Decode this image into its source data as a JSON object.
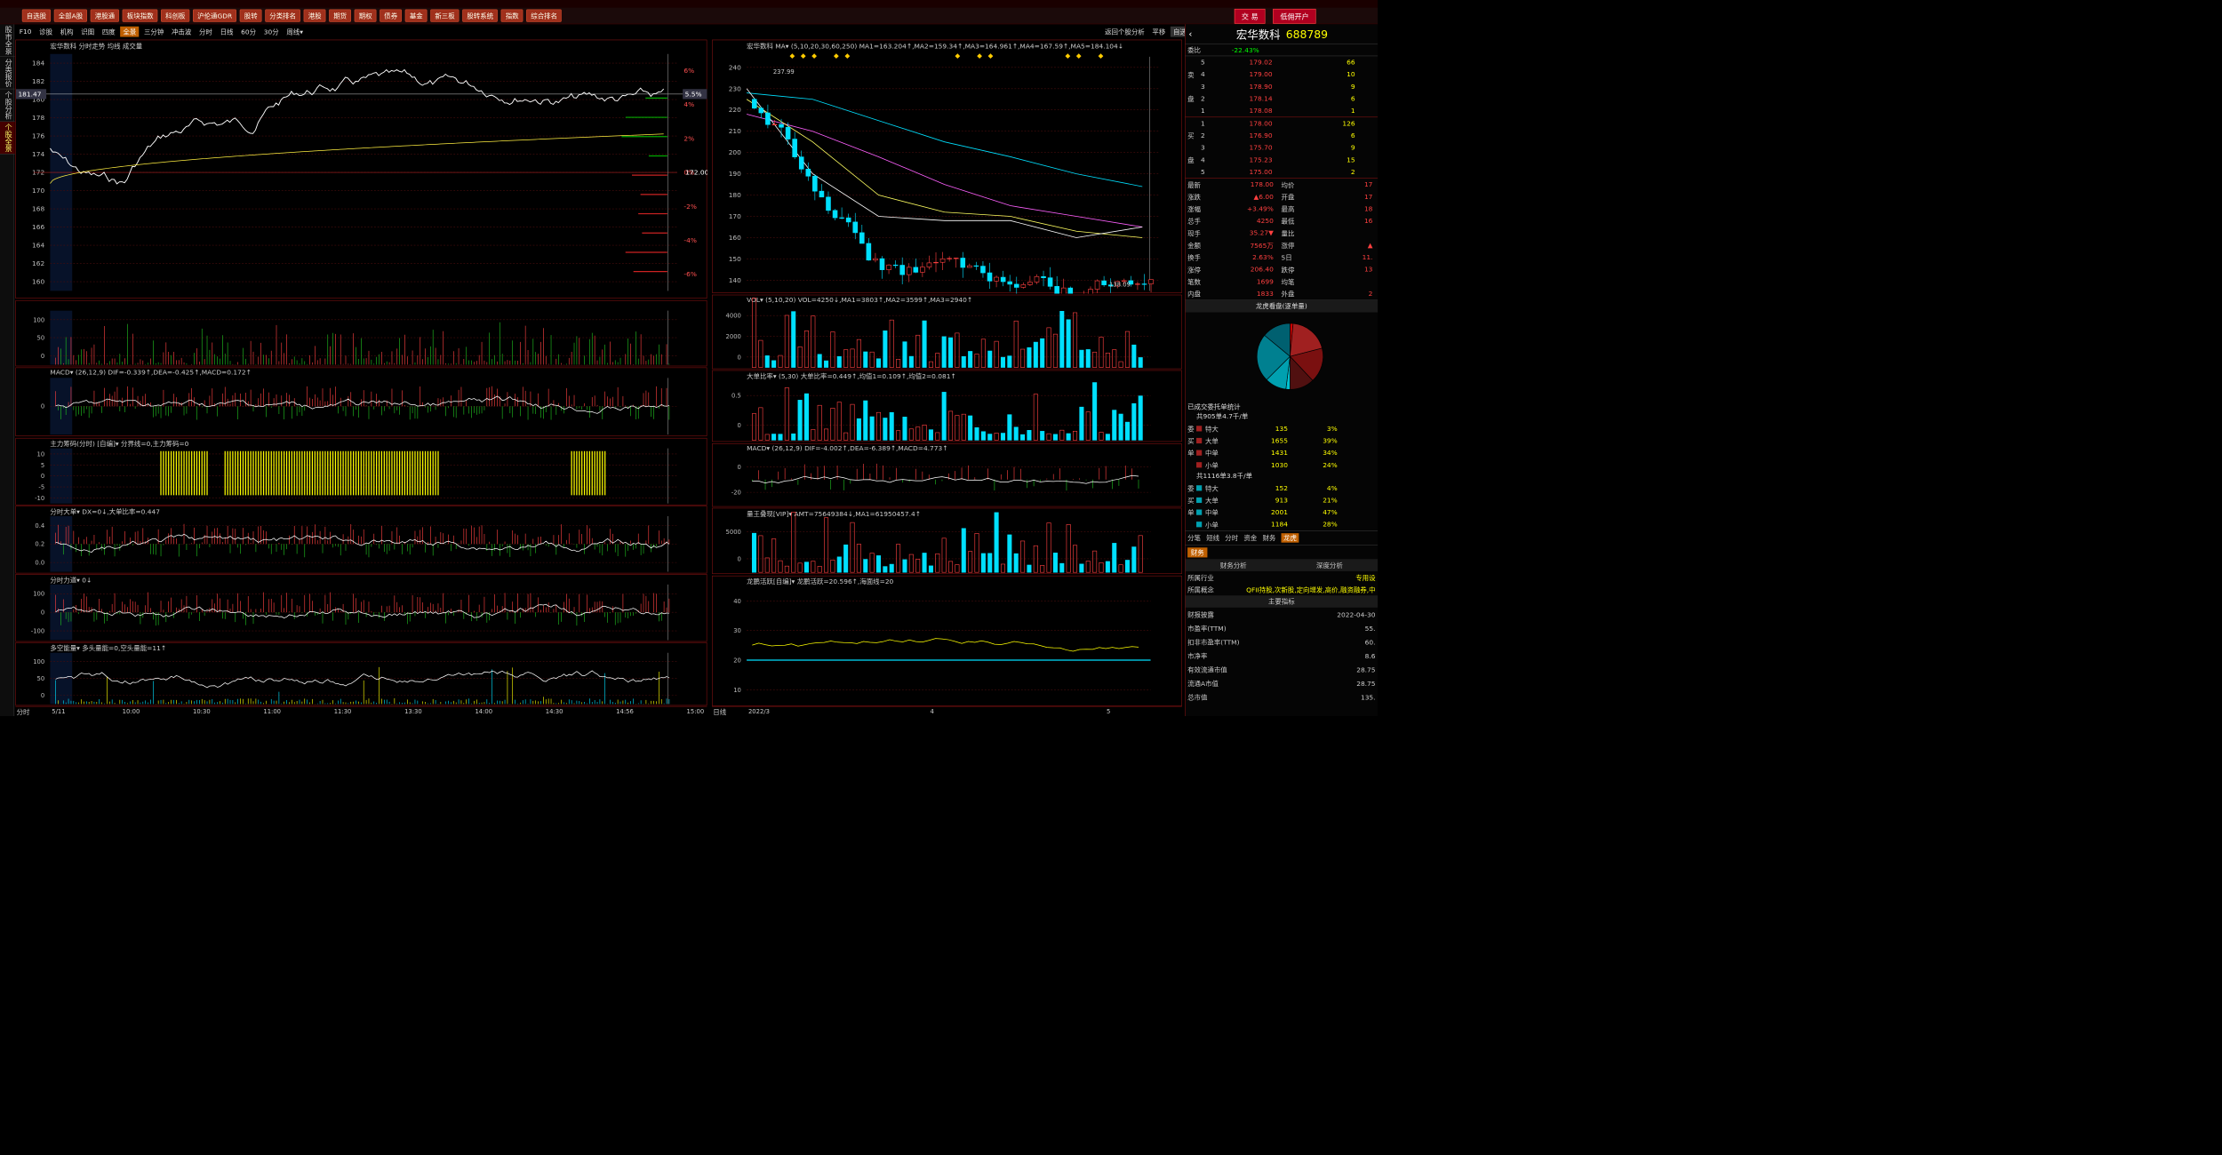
{
  "window": {
    "title": "宏华数科"
  },
  "menu": [
    "自选股",
    "全部A股",
    "港股通",
    "板块指数",
    "科创板",
    "沪伦通GDR",
    "股转",
    "分类排名",
    "港股",
    "期货",
    "期权",
    "债券",
    "基金",
    "新三板",
    "股转系统",
    "指数",
    "综合排名"
  ],
  "top_right": {
    "trade": "交 易",
    "open_account": "低佣开户"
  },
  "sidebar": [
    "股市全景",
    "分类报价",
    "个股分析",
    "个股全景"
  ],
  "left_tabs": [
    "F10",
    "诊股",
    "机构",
    "识图",
    "四度",
    "全景",
    "三分钟",
    "冲击波",
    "分时",
    "日线",
    "60分",
    "30分",
    "周线▾"
  ],
  "right_tabs": {
    "back": "返回个股分析",
    "flat": "平移",
    "selfsel": "自选▾"
  },
  "intraday": {
    "header": "宏华数科 分时走势 均线 成交量",
    "price_ticks": [
      "184",
      "182",
      "180",
      "178",
      "176",
      "174",
      "172",
      "170",
      "168",
      "166",
      "164",
      "162",
      "160"
    ],
    "pct_ticks": [
      "6%",
      "4%",
      "2%",
      "0%",
      "-2%",
      "-4%",
      "-6%"
    ],
    "cursor_price": "181.47",
    "cursor_pct": "5.5%",
    "prev_close": "172.00"
  },
  "sub_panels": [
    {
      "name": "vol",
      "header": "",
      "ticks": [
        "100",
        "50",
        "0"
      ]
    },
    {
      "name": "macd",
      "header": "MACD▾ (26,12,9) DIF=-0.339↑,DEA=-0.425↑,MACD=0.172↑",
      "ticks": [
        "0"
      ]
    },
    {
      "name": "zljm",
      "header": "主力筹码(分时) [自编]▾ 分界线=0,主力筹码=0",
      "ticks": [
        "10",
        "5",
        "0",
        "-5",
        "-10"
      ]
    },
    {
      "name": "fsdd",
      "header": "分时大单▾ DX=0↓,大单比率=0.447",
      "ticks": [
        "0.4",
        "0.2",
        "0.0"
      ]
    },
    {
      "name": "fsld",
      "header": "分时力道▾ 0↓",
      "ticks": [
        "100",
        "0",
        "-100"
      ]
    },
    {
      "name": "dkn",
      "header": "多空能量▾ 多头量能=0,空头量能=11↑",
      "ticks": [
        "100",
        "50",
        "0"
      ]
    }
  ],
  "time_axis": {
    "label": "分时",
    "ticks": [
      "5/11",
      "10:00",
      "10:30",
      "11:00",
      "11:30",
      "13:30",
      "14:00",
      "14:30",
      "14:56",
      "15:00"
    ]
  },
  "daily": {
    "header": "宏华数科 MA▾ (5,10,20,30,60,250) MA1=163.204↑,MA2=159.34↑,MA3=164.961↑,MA4=167.59↑,MA5=184.104↓",
    "price_ticks": [
      "240",
      "230",
      "220",
      "210",
      "200",
      "190",
      "180",
      "170",
      "160",
      "150",
      "140"
    ],
    "high_label": "237.99",
    "low_label": "138.09"
  },
  "daily_subs": [
    {
      "name": "vol",
      "header": "VOL▾ (5,10,20) VOL=4250↓,MA1=3803↑,MA2=3599↑,MA3=2940↑",
      "ticks": [
        "4000",
        "2000",
        "0"
      ]
    },
    {
      "name": "ddbl",
      "header": "大单比率▾ (5,30) 大单比率=0.449↑,均值1=0.109↑,均值2=0.081↑",
      "ticks": [
        "0.5",
        "0"
      ]
    },
    {
      "name": "macd",
      "header": "MACD▾ (26,12,9) DIF=-4.002↑,DEA=-6.389↑,MACD=4.773↑",
      "ticks": [
        "0",
        "-20"
      ]
    },
    {
      "name": "lwdx",
      "header": "量王叠现[VIP]▾ AMT=75649384↓,MA1=61950457.4↑",
      "ticks": [
        "5000",
        "0"
      ]
    },
    {
      "name": "lthy",
      "header": "龙鹏活跃[自编]▾ 龙鹏活跃=20.596↑,海面线=20",
      "ticks": [
        "40",
        "30",
        "20",
        "10"
      ]
    }
  ],
  "daily_axis": {
    "label": "日线",
    "ticks": [
      "2022/3",
      "4",
      "5"
    ]
  },
  "quote": {
    "name": "宏华数科",
    "code": "688789",
    "weibi_label": "委比",
    "weibi": "-22.43%",
    "asks": [
      {
        "l": "5",
        "p": "179.02",
        "v": "66"
      },
      {
        "l": "4",
        "p": "179.00",
        "v": "10"
      },
      {
        "l": "3",
        "p": "178.90",
        "v": "9"
      },
      {
        "l": "2",
        "p": "178.14",
        "v": "6"
      },
      {
        "l": "1",
        "p": "178.08",
        "v": "1"
      }
    ],
    "bids": [
      {
        "l": "1",
        "p": "178.00",
        "v": "126"
      },
      {
        "l": "2",
        "p": "176.90",
        "v": "6"
      },
      {
        "l": "3",
        "p": "175.70",
        "v": "9"
      },
      {
        "l": "4",
        "p": "175.23",
        "v": "15"
      },
      {
        "l": "5",
        "p": "175.00",
        "v": "2"
      }
    ],
    "stats": [
      [
        "最新",
        "178.00",
        "均价",
        "17"
      ],
      [
        "涨跌",
        "▲6.00",
        "开盘",
        "17"
      ],
      [
        "涨幅",
        "+3.49%",
        "最高",
        "18"
      ],
      [
        "总手",
        "4250",
        "最低",
        "16"
      ],
      [
        "现手",
        "35.27▼",
        "量比",
        ""
      ],
      [
        "金额",
        "7565万",
        "涨停",
        "▲"
      ],
      [
        "换手",
        "2.63%",
        "5日",
        "11."
      ],
      [
        "涨停",
        "206.40",
        "跌停",
        "13"
      ],
      [
        "笔数",
        "1699",
        "均笔",
        ""
      ],
      [
        "内盘",
        "1833",
        "外盘",
        "2"
      ]
    ],
    "pie_title": "龙虎看盘(逐单量)",
    "entrust_title": "已成交委托单统计",
    "group1": {
      "title": "共905单4.7千/单",
      "rows": [
        [
          "特大",
          "135",
          "3%"
        ],
        [
          "大单",
          "1655",
          "39%"
        ],
        [
          "中单",
          "1431",
          "34%"
        ],
        [
          "小单",
          "1030",
          "24%"
        ]
      ]
    },
    "group2": {
      "title": "共1116单3.8千/单",
      "rows": [
        [
          "特大",
          "152",
          "4%"
        ],
        [
          "大单",
          "913",
          "21%"
        ],
        [
          "中单",
          "2001",
          "47%"
        ],
        [
          "小单",
          "1184",
          "28%"
        ]
      ]
    },
    "bottom_tabs": [
      "分笔",
      "短线",
      "分时",
      "资金",
      "财务",
      "龙虎"
    ],
    "fin_tab": "财务",
    "fin_sub": [
      "财务分析",
      "深度分析"
    ],
    "fin": [
      [
        "所属行业",
        "专用设"
      ],
      [
        "所属概念",
        "QFII持股,次新股,定向增发,高价,融资融券,中"
      ]
    ],
    "main_index": "主要指标",
    "indexes": [
      [
        "财报披露",
        "2022-04-30"
      ],
      [
        "市盈率(TTM)",
        "55."
      ],
      [
        "扣非市盈率(TTM)",
        "60."
      ],
      [
        "市净率",
        "8.6"
      ],
      [
        "有效流通市值",
        "28.75"
      ],
      [
        "流通A市值",
        "28.75"
      ],
      [
        "总市值",
        "135."
      ]
    ],
    "bs_labels": [
      "卖",
      "盘",
      "买",
      "盘"
    ],
    "side_labels": [
      "委",
      "买",
      "单",
      "委",
      "买",
      "单"
    ]
  },
  "colors": {
    "up": "#ff3030",
    "down": "#00e0ff",
    "yellow": "#ffff00",
    "frame": "#7a1010"
  }
}
